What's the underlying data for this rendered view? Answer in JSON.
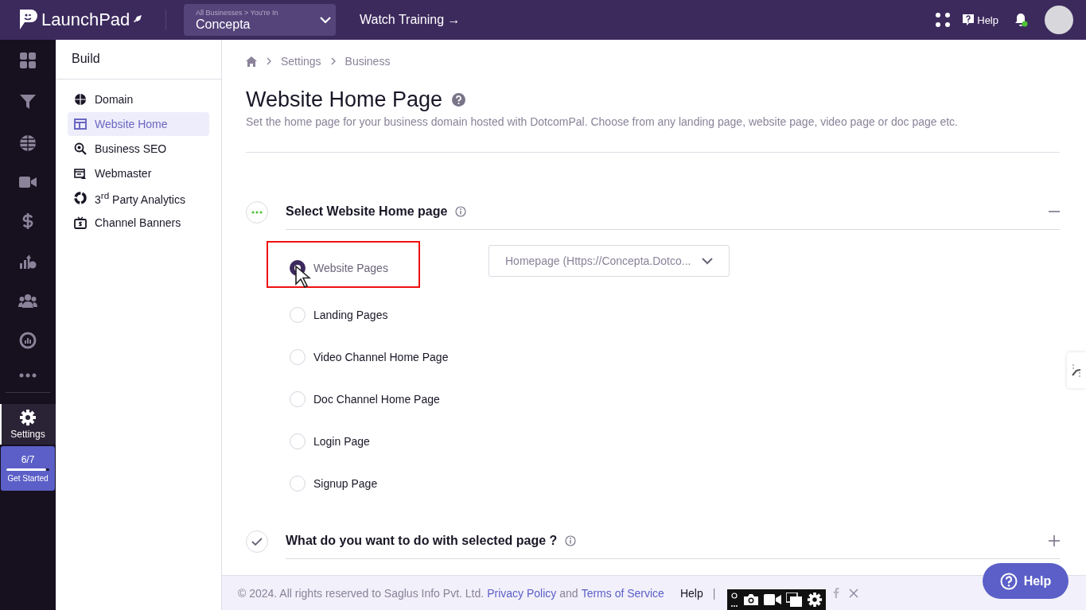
{
  "topbar": {
    "logo": "LaunchPad",
    "business_switcher": {
      "caption": "All Businesses > You're In",
      "value": "Concepta"
    },
    "training_link": "Watch Training →",
    "help": "Help",
    "notification_dot": true
  },
  "rail": {
    "settings": {
      "label": "Settings",
      "selected": true
    },
    "progress": {
      "count": "6/7",
      "level": 0.92,
      "label": "Get Started"
    }
  },
  "sidebar": {
    "title": "Build",
    "items": [
      {
        "label": "Domain",
        "selected": false
      },
      {
        "label": "Website Home",
        "selected": true
      },
      {
        "label": "Business SEO",
        "selected": false
      },
      {
        "label": "Webmaster",
        "selected": false
      },
      {
        "label": "3$^{rd}$ Party Analytics",
        "selected": false
      },
      {
        "label": "Channel Banners",
        "selected": false
      }
    ]
  },
  "breadcrumb": [
    "Settings",
    "Business"
  ],
  "page": {
    "title": "Website Home Page",
    "description": "Set the home page for your business domain hosted with DotcomPal. Choose from any landing page, website page, video page or doc page etc."
  },
  "sections": [
    {
      "title": "Select Website Home page",
      "expanded": true,
      "completed": false,
      "options": [
        {
          "label": "Website Pages",
          "selected": true,
          "highlighted": true
        },
        {
          "label": "Landing Pages",
          "selected": false,
          "highlighted": false
        },
        {
          "label": "Video Channel Home Page",
          "selected": false,
          "highlighted": false
        },
        {
          "label": "Doc Channel Home Page",
          "selected": false,
          "highlighted": false
        },
        {
          "label": "Login Page",
          "selected": false,
          "highlighted": false
        },
        {
          "label": "Signup Page",
          "selected": false,
          "highlighted": false
        }
      ],
      "dropdown": {
        "value": "Homepage (Https://Concepta.Dotco..."
      }
    },
    {
      "title": "What do you want to do with selected page ?",
      "expanded": false,
      "completed": true
    }
  ],
  "footer": {
    "copyright": "©  2024. All rights reserved to Saglus Info Pvt. Ltd.",
    "privacy": "Privacy Policy",
    "and": "and",
    "terms": "Terms of Service",
    "help": "Help",
    "separator": "|"
  },
  "help_button": "Help"
}
